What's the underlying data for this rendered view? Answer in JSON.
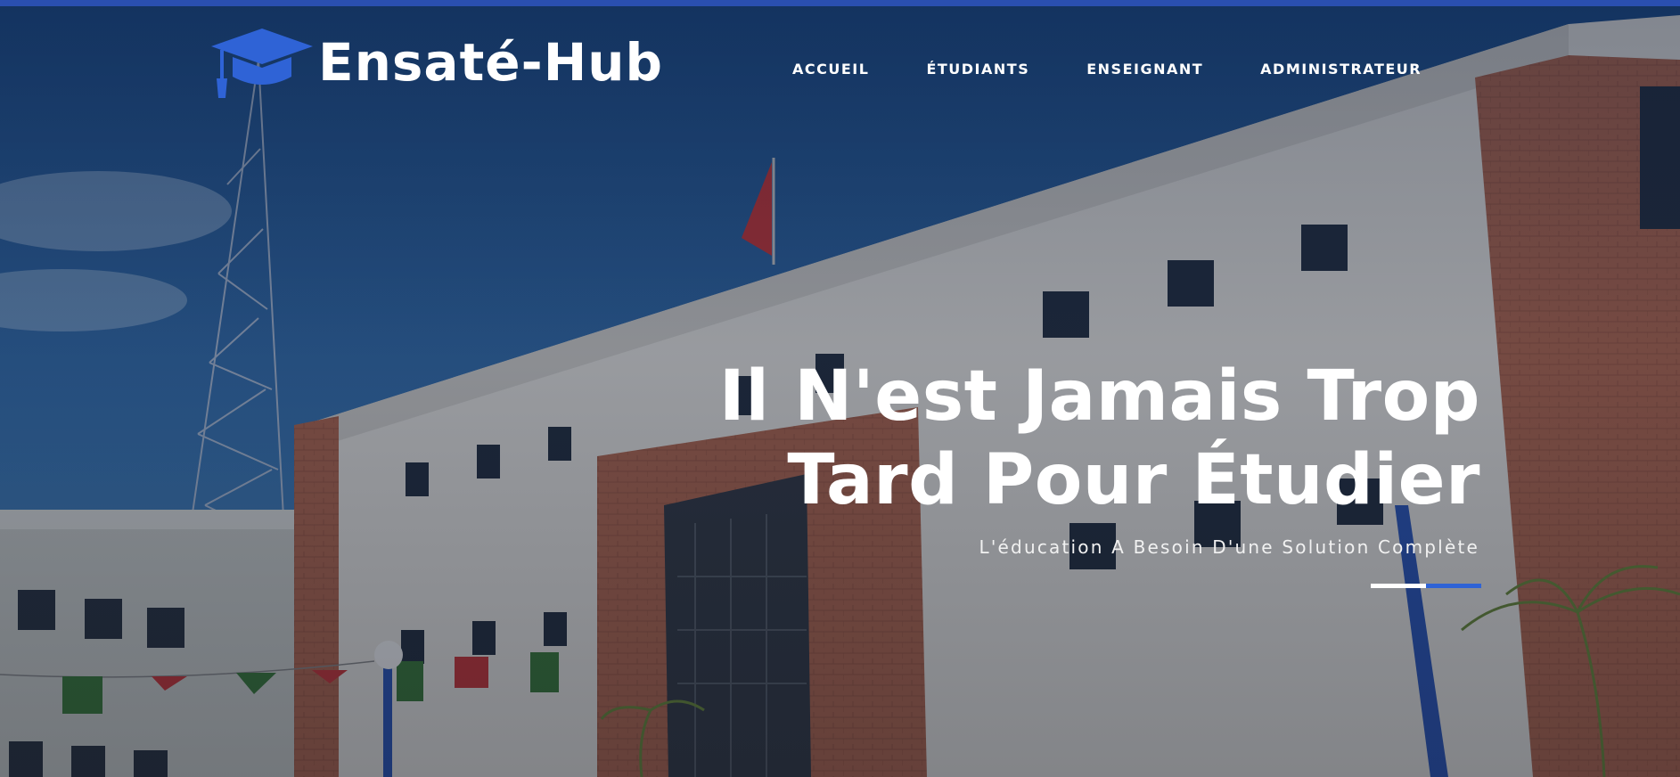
{
  "brand": {
    "name": "Ensaté-Hub",
    "icon": "graduation-cap-icon",
    "accent": "#2f63d6"
  },
  "nav": {
    "items": [
      {
        "label": "ACCUEIL"
      },
      {
        "label": "ÉTUDIANTS"
      },
      {
        "label": "ENSEIGNANT"
      },
      {
        "label": "ADMINISTRATEUR"
      }
    ]
  },
  "hero": {
    "headline_line1": "Il N'est Jamais Trop",
    "headline_line2": "Tard Pour Étudier",
    "subtitle": "L'éducation A Besoin D'une Solution Complète",
    "underline_colors": [
      "#ffffff",
      "#2f63d6"
    ]
  }
}
